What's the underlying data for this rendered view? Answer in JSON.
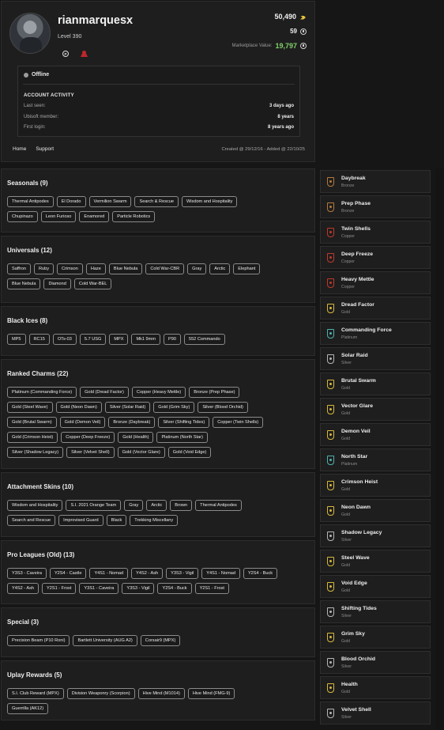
{
  "profile": {
    "username": "rianmarquesx",
    "level": "Level 390",
    "renown": "50,490",
    "credits": "59",
    "marketplace_label": "Marketplace Value:",
    "marketplace_value": "19,797",
    "platform_icon": "playstation-icon",
    "status": "Offline",
    "activity_title": "ACCOUNT ACTIVITY",
    "activity": [
      {
        "label": "Last seen:",
        "value": "3 days ago"
      },
      {
        "label": "Ubisoft member:",
        "value": "8 years"
      },
      {
        "label": "First login:",
        "value": "8 years ago"
      }
    ],
    "nav": [
      "Home",
      "Support"
    ],
    "created": "Created @ 29/12/16 - Added @ 22/10/25"
  },
  "sections": [
    {
      "title": "Seasonals (9)",
      "rows": [
        [
          "Thermal Antipodes",
          "El Dorado",
          "Vermilion Swarm",
          "Search & Rescue",
          "Wisdom and Hospitality"
        ],
        [
          "Chupinazo",
          "Leon Furioso",
          "Enamored",
          "Particle Robotics"
        ]
      ]
    },
    {
      "title": "Universals (12)",
      "rows": [
        [
          "Saffron",
          "Ruby",
          "Crimson",
          "Haze",
          "Blue Nebula",
          "Cold War-CBR",
          "Gray",
          "Arctic",
          "Elephant"
        ],
        [
          "Blue Nebula",
          "Diamond",
          "Cold War-BEL"
        ]
      ]
    },
    {
      "title": "Black Ices (8)",
      "rows": [
        [
          "MP5",
          "RC15",
          "OTs-03",
          "5.7 USG",
          "MPX",
          "Mk1 9mm",
          "P90",
          "552 Commando"
        ]
      ]
    },
    {
      "title": "Ranked Charms (22)",
      "rows": [
        [
          "Platinum (Commanding Force)",
          "Gold (Dread Factor)",
          "Copper (Heavy Mettle)",
          "Bronze (Prep Phase)"
        ],
        [
          "Gold (Steel Wave)",
          "Gold (Neon Dawn)",
          "Silver (Solar Raid)",
          "Gold (Grim Sky)",
          "Silver (Blood Orchid)"
        ],
        [
          "Gold (Brutal Swarm)",
          "Gold (Demon Veil)",
          "Bronze (Daybreak)",
          "Silver (Shifting Tides)",
          "Copper (Twin Shells)"
        ],
        [
          "Gold (Crimson Heist)",
          "Copper (Deep Freeze)",
          "Gold (Health)",
          "Platinum (North Star)"
        ],
        [
          "Silver (Shadow Legacy)",
          "Silver (Velvet Shell)",
          "Gold (Vector Glare)",
          "Gold (Void Edge)"
        ]
      ]
    },
    {
      "title": "Attachment Skins (10)",
      "rows": [
        [
          "Wisdom and Hospitality",
          "S.I. 2021 Orange Team",
          "Gray",
          "Arctic",
          "Brown",
          "Thermal Antipodes"
        ],
        [
          "Search and Rescue",
          "Improvised Guard",
          "Black",
          "Trekking Miscellany"
        ]
      ]
    },
    {
      "title": "Pro Leagues (Old) (13)",
      "rows": [
        [
          "Y3S3 - Caveira",
          "Y2S4 - Castle",
          "Y4S1 - Nomad",
          "Y4S2 - Ash",
          "Y3S3 - Vigil",
          "Y4S1 - Nomad",
          "Y2S4 - Buck"
        ],
        [
          "Y4S2 - Ash",
          "Y2S1 - Frost",
          "Y3S1 - Caveira",
          "Y3S3 - Vigil",
          "Y2S4 - Buck",
          "Y2S1 - Frost"
        ]
      ]
    },
    {
      "title": "Special (3)",
      "rows": [
        [
          "Precision Beam (P10 Roni)",
          "Bartlett University (AUG A2)",
          "Corsair9 (MPX)"
        ]
      ]
    },
    {
      "title": "Uplay Rewards (5)",
      "rows": [
        [
          "S.I. Club Reward (MPX)",
          "Division Weaponry (Scorpion)",
          "Hive Mind (M1014)",
          "Hive Mind (FMG-9)"
        ],
        [
          "Guerrilla (AK12)"
        ]
      ]
    }
  ],
  "charms": [
    {
      "name": "Daybreak",
      "tier": "Bronze",
      "color": "#b57a3c"
    },
    {
      "name": "Prep Phase",
      "tier": "Bronze",
      "color": "#b57a3c"
    },
    {
      "name": "Twin Shells",
      "tier": "Copper",
      "color": "#c0392b"
    },
    {
      "name": "Deep Freeze",
      "tier": "Copper",
      "color": "#c0392b"
    },
    {
      "name": "Heavy Mettle",
      "tier": "Copper",
      "color": "#c0392b"
    },
    {
      "name": "Dread Factor",
      "tier": "Gold",
      "color": "#d8b93a"
    },
    {
      "name": "Commanding Force",
      "tier": "Platinum",
      "color": "#4fb3b0"
    },
    {
      "name": "Solar Raid",
      "tier": "Silver",
      "color": "#b7b7b7"
    },
    {
      "name": "Brutal Swarm",
      "tier": "Gold",
      "color": "#d8b93a"
    },
    {
      "name": "Vector Glare",
      "tier": "Gold",
      "color": "#d8b93a"
    },
    {
      "name": "Demon Veil",
      "tier": "Gold",
      "color": "#d8b93a"
    },
    {
      "name": "North Star",
      "tier": "Platinum",
      "color": "#4fb3b0"
    },
    {
      "name": "Crimson Heist",
      "tier": "Gold",
      "color": "#d8b93a"
    },
    {
      "name": "Neon Dawn",
      "tier": "Gold",
      "color": "#d8b93a"
    },
    {
      "name": "Shadow Legacy",
      "tier": "Silver",
      "color": "#b7b7b7"
    },
    {
      "name": "Steel Wave",
      "tier": "Gold",
      "color": "#d8b93a"
    },
    {
      "name": "Void Edge",
      "tier": "Gold",
      "color": "#d8b93a"
    },
    {
      "name": "Shifting Tides",
      "tier": "Silver",
      "color": "#b7b7b7"
    },
    {
      "name": "Grim Sky",
      "tier": "Gold",
      "color": "#d8b93a"
    },
    {
      "name": "Blood Orchid",
      "tier": "Silver",
      "color": "#b7b7b7"
    },
    {
      "name": "Health",
      "tier": "Gold",
      "color": "#d8b93a"
    },
    {
      "name": "Velvet Shell",
      "tier": "Silver",
      "color": "#b7b7b7"
    }
  ]
}
